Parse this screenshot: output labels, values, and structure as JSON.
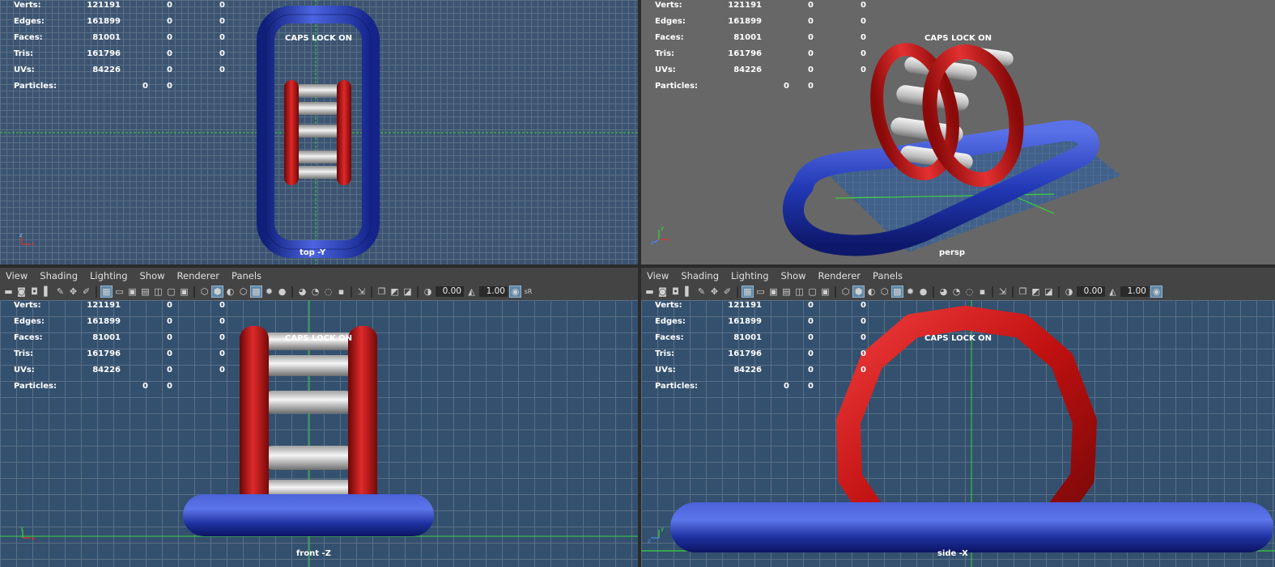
{
  "menu": [
    "View",
    "Shading",
    "Lighting",
    "Show",
    "Renderer",
    "Panels"
  ],
  "toolbar": {
    "field_a": "0.00",
    "field_b": "1.00"
  },
  "hud": {
    "verts": {
      "label": "Verts:",
      "a": "121191",
      "b": "0",
      "c": "0"
    },
    "edges": {
      "label": "Edges:",
      "a": "161899",
      "b": "0",
      "c": "0"
    },
    "faces": {
      "label": "Faces:",
      "a": "81001",
      "b": "0",
      "c": "0"
    },
    "tris": {
      "label": "Tris:",
      "a": "161796",
      "b": "0",
      "c": "0"
    },
    "uvs": {
      "label": "UVs:",
      "a": "84226",
      "b": "0",
      "c": "0"
    },
    "particles": {
      "label": "Particles:",
      "a": "0",
      "b": "0"
    }
  },
  "caps_lock": "CAPS LOCK ON",
  "cameras": {
    "top": "top -Y",
    "persp": "persp",
    "front": "front -Z",
    "side": "side -X"
  },
  "colors": {
    "inflatable_blue": "#2238b5",
    "inflatable_red": "#cc1515",
    "roller_white": "#d8d8d8",
    "axis_green": "#3ad43a",
    "ortho_grid": "#3b5471",
    "persp_bg": "#676767"
  }
}
